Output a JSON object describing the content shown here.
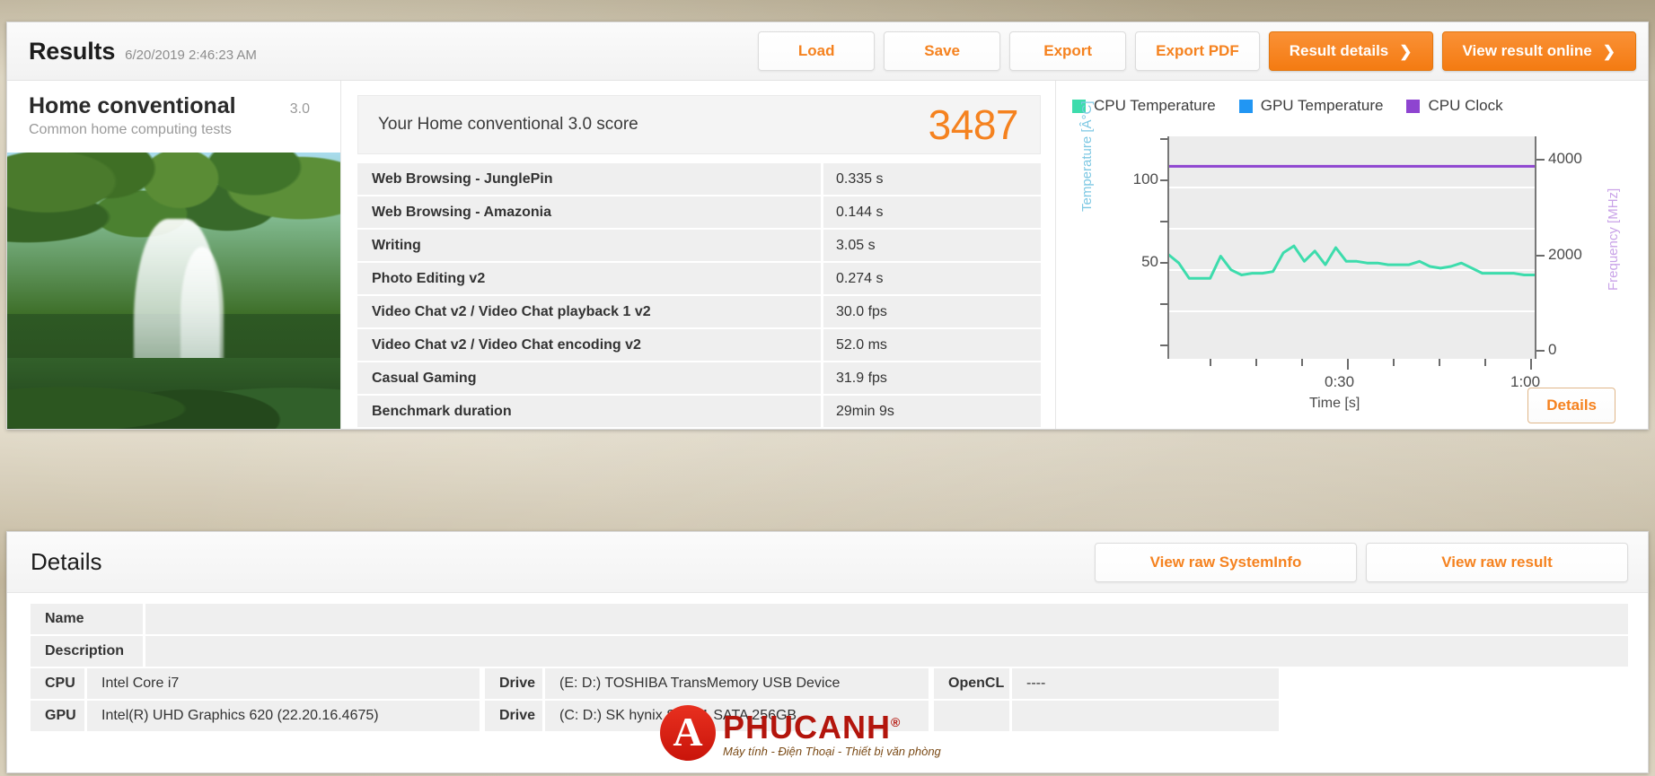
{
  "header": {
    "title": "Results",
    "date": "6/20/2019 2:46:23 AM",
    "buttons": [
      {
        "label": "Load",
        "style": "light"
      },
      {
        "label": "Save",
        "style": "light"
      },
      {
        "label": "Export",
        "style": "light"
      },
      {
        "label": "Export PDF",
        "style": "light"
      },
      {
        "label": "Result details",
        "style": "primary",
        "chevron": "❯"
      },
      {
        "label": "View result online",
        "style": "primary",
        "chevron": "❯"
      }
    ]
  },
  "benchmark": {
    "name": "Home conventional",
    "version": "3.0",
    "description": "Common home computing tests",
    "image_alt": "jungle-waterfall-photo"
  },
  "score": {
    "label": "Your Home conventional 3.0 score",
    "value": "3487",
    "accent_color": "#f5821f"
  },
  "results_table": {
    "rows": [
      {
        "name": "Web Browsing - JunglePin",
        "value": "0.335 s"
      },
      {
        "name": "Web Browsing - Amazonia",
        "value": "0.144 s"
      },
      {
        "name": "Writing",
        "value": "3.05 s"
      },
      {
        "name": "Photo Editing v2",
        "value": "0.274 s"
      },
      {
        "name": "Video Chat v2 / Video Chat playback 1 v2",
        "value": "30.0 fps"
      },
      {
        "name": "Video Chat v2 / Video Chat encoding v2",
        "value": "52.0 ms"
      },
      {
        "name": "Casual Gaming",
        "value": "31.9 fps"
      },
      {
        "name": "Benchmark duration",
        "value": "29min 9s"
      }
    ]
  },
  "chart_data": {
    "type": "line",
    "title": "",
    "xlabel": "Time [s]",
    "ylabel": "Temperature [Â°C]",
    "y2label": "Frequency [MHz]",
    "xlim": [
      0,
      70
    ],
    "ylim": [
      0,
      130
    ],
    "y2lim": [
      0,
      5200
    ],
    "grid": true,
    "legend_position": "top-left",
    "xticks": [
      "0:30",
      "1:00"
    ],
    "xtick_values": [
      30,
      60
    ],
    "yticks": [
      50,
      100
    ],
    "y2ticks": [
      0,
      2000,
      4000
    ],
    "series": [
      {
        "name": "CPU Temperature",
        "color": "#3ddcac",
        "axis": "left",
        "x": [
          0,
          2,
          4,
          6,
          8,
          10,
          12,
          14,
          16,
          18,
          20,
          22,
          24,
          26,
          28,
          30,
          32,
          34,
          36,
          38,
          40,
          42,
          44,
          46,
          48,
          50,
          52,
          54,
          56,
          58,
          60,
          62,
          64,
          66,
          68,
          70
        ],
        "values": [
          61,
          56,
          47,
          47,
          47,
          60,
          52,
          49,
          50,
          50,
          51,
          62,
          66,
          57,
          63,
          55,
          65,
          57,
          57,
          56,
          56,
          55,
          55,
          55,
          57,
          54,
          53,
          54,
          56,
          53,
          50,
          50,
          50,
          50,
          49,
          49
        ]
      },
      {
        "name": "GPU Temperature",
        "color": "#2196f3",
        "axis": "left",
        "x": [],
        "values": []
      },
      {
        "name": "CPU Clock",
        "color": "#8e44d0",
        "axis": "right",
        "x": [
          0,
          10,
          20,
          30,
          40,
          50,
          60,
          70
        ],
        "values": [
          4500,
          4500,
          4500,
          4500,
          4500,
          4500,
          4500,
          4500
        ]
      }
    ],
    "details_button": "Details"
  },
  "details": {
    "title": "Details",
    "buttons": [
      {
        "label": "View raw SystemInfo"
      },
      {
        "label": "View raw result"
      }
    ],
    "simple_rows": [
      {
        "key": "Name",
        "value": ""
      },
      {
        "key": "Description",
        "value": ""
      }
    ],
    "spec_rows": [
      [
        {
          "key": "CPU",
          "value": "Intel Core i7"
        },
        {
          "key": "Drive",
          "value": "(E: D:) TOSHIBA TransMemory USB Device"
        },
        {
          "key": "OpenCL",
          "value": "----"
        }
      ],
      [
        {
          "key": "GPU",
          "value": "Intel(R) UHD Graphics 620 (22.20.16.4675)"
        },
        {
          "key": "Drive",
          "value": "(C: D:) SK hynix SC311 SATA 256GB"
        },
        {
          "key": "",
          "value": ""
        }
      ]
    ]
  },
  "watermark": {
    "mark": "A",
    "name": "PHUCANH",
    "registered": "®",
    "tagline": "Máy tính - Điện Thoại - Thiết bị văn phòng"
  }
}
